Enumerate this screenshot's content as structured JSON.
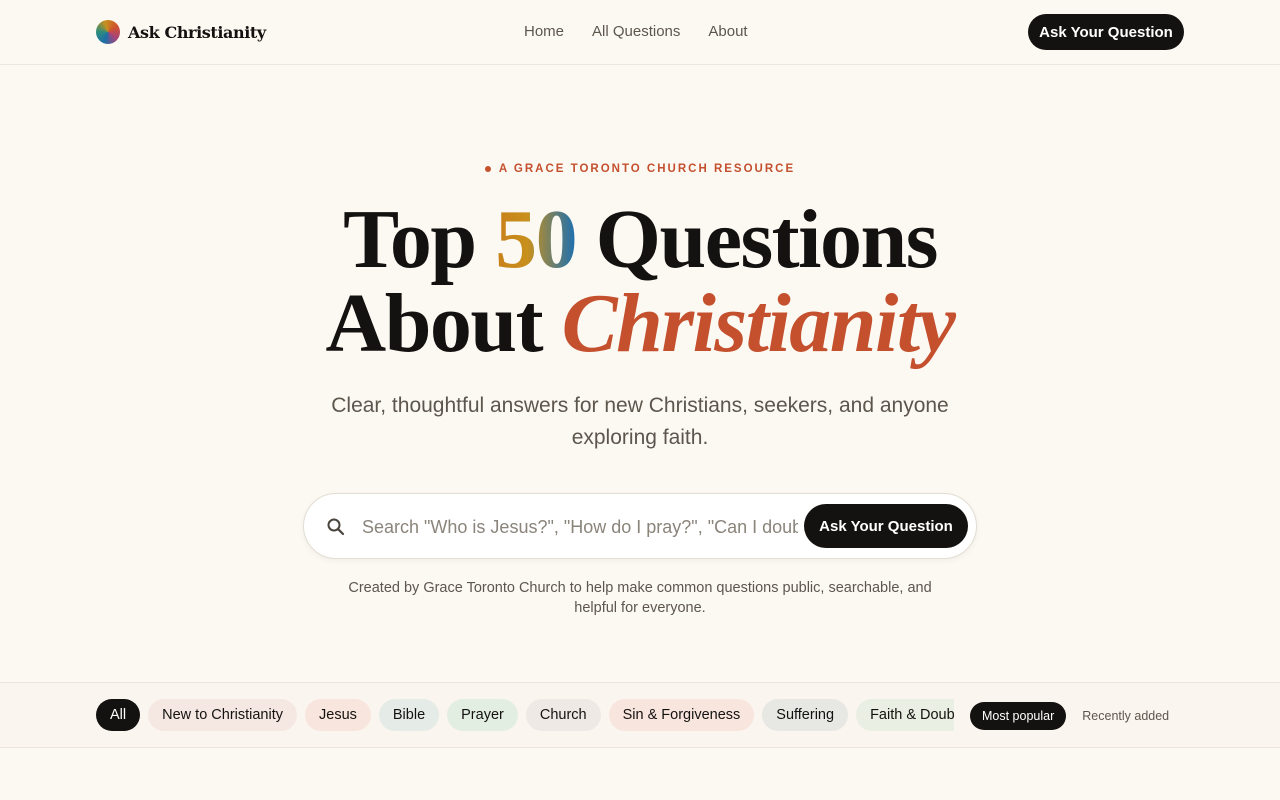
{
  "header": {
    "brand_name": "Ask Christianity",
    "nav": [
      {
        "label": "Home"
      },
      {
        "label": "All Questions"
      },
      {
        "label": "About"
      }
    ],
    "cta_label": "Ask Your Question"
  },
  "hero": {
    "eyebrow": "A GRACE TORONTO CHURCH RESOURCE",
    "title_line1_pre": "Top ",
    "title_number": "50",
    "title_line1_post": " Questions",
    "title_line2_pre": "About ",
    "title_accent": "Christianity",
    "subtitle": "Clear, thoughtful answers for new Christians, seekers, and anyone exploring faith."
  },
  "search": {
    "placeholder": "Search \"Who is Jesus?\", \"How do I pray?\", \"Can I doubt God?\"",
    "value": "",
    "button_label": "Ask Your Question"
  },
  "credit": "Created by Grace Toronto Church to help make common questions public, searchable, and helpful for everyone.",
  "filters": {
    "categories": [
      {
        "label": "All",
        "active": true,
        "color": "#141210"
      },
      {
        "label": "New to Christianity",
        "active": false,
        "color": "#f5e8e3"
      },
      {
        "label": "Jesus",
        "active": false,
        "color": "#f8e6de"
      },
      {
        "label": "Bible",
        "active": false,
        "color": "#e5ebe6"
      },
      {
        "label": "Prayer",
        "active": false,
        "color": "#e3eee3"
      },
      {
        "label": "Church",
        "active": false,
        "color": "#efe9e6"
      },
      {
        "label": "Sin & Forgiveness",
        "active": false,
        "color": "#f8e6de"
      },
      {
        "label": "Suffering",
        "active": false,
        "color": "#e7e8e3"
      },
      {
        "label": "Faith & Doubt",
        "active": false,
        "color": "#e9efe2"
      }
    ],
    "sort": {
      "active_label": "Most popular",
      "other_label": "Recently added"
    }
  },
  "colors": {
    "accent": "#c4502e",
    "ink": "#141210",
    "background": "#fcf9f3"
  }
}
